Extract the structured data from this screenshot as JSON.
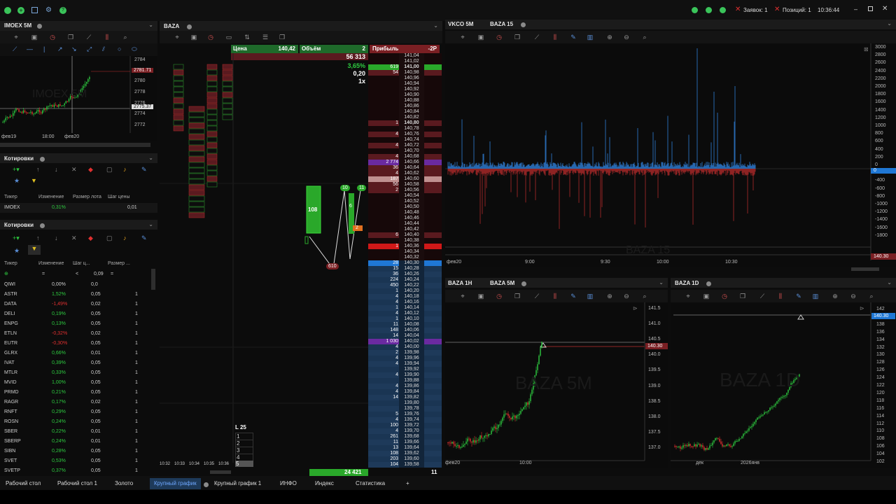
{
  "topbar": {
    "orders_label": "Заявок: 1",
    "positions_label": "Позиций: 1",
    "time": "10:36:44"
  },
  "left_chart": {
    "title": "IMOEX 5M",
    "watermark": "IMOEX 5M",
    "price_ticks": [
      "2784",
      "2780",
      "2778",
      "2776",
      "2774",
      "2772"
    ],
    "price_tag": "2781.71",
    "price_tag2": "2775.37",
    "time_ticks": [
      "фев19",
      "18:00",
      "фев20"
    ]
  },
  "quotes1": {
    "title": "Котировки",
    "headers": [
      "Тикер",
      "Изменение",
      "Размер лота",
      "Шаг цены"
    ],
    "row": {
      "ticker": "IMOEX",
      "change": "0,31%",
      "lot": "",
      "step": "0,01"
    }
  },
  "quotes2": {
    "title": "Котировки",
    "headers": [
      "Тикер",
      "Изменение",
      "Шаг ц...",
      "Размер ..."
    ],
    "filter": {
      "sign": "<",
      "value": "0,09"
    },
    "rows": [
      {
        "t": "QIWI",
        "c": "0,00%",
        "s": "0,0",
        "l": ""
      },
      {
        "t": "ASTR",
        "c": "1,52%",
        "s": "0,05",
        "l": "1"
      },
      {
        "t": "DATA",
        "c": "-1,49%",
        "s": "0,02",
        "l": "1"
      },
      {
        "t": "DELI",
        "c": "0,19%",
        "s": "0,05",
        "l": "1"
      },
      {
        "t": "ENPG",
        "c": "0,13%",
        "s": "0,05",
        "l": "1"
      },
      {
        "t": "ETLN",
        "c": "-0,32%",
        "s": "0,02",
        "l": "1"
      },
      {
        "t": "EUTR",
        "c": "-0,30%",
        "s": "0,05",
        "l": "1"
      },
      {
        "t": "GLRX",
        "c": "0,66%",
        "s": "0,01",
        "l": "1"
      },
      {
        "t": "IVAT",
        "c": "0,39%",
        "s": "0,05",
        "l": "1"
      },
      {
        "t": "MTLR",
        "c": "0,33%",
        "s": "0,05",
        "l": "1"
      },
      {
        "t": "MVID",
        "c": "1,00%",
        "s": "0,05",
        "l": "1"
      },
      {
        "t": "PRMD",
        "c": "0,21%",
        "s": "0,05",
        "l": "1"
      },
      {
        "t": "RAGR",
        "c": "0,17%",
        "s": "0,02",
        "l": "1"
      },
      {
        "t": "RNFT",
        "c": "0,29%",
        "s": "0,05",
        "l": "1"
      },
      {
        "t": "ROSN",
        "c": "0,24%",
        "s": "0,05",
        "l": "1"
      },
      {
        "t": "SBER",
        "c": "0,22%",
        "s": "0,01",
        "l": "1"
      },
      {
        "t": "SBERP",
        "c": "0,24%",
        "s": "0,01",
        "l": "1"
      },
      {
        "t": "SIBN",
        "c": "0,28%",
        "s": "0,05",
        "l": "1"
      },
      {
        "t": "SVET",
        "c": "0,53%",
        "s": "0,05",
        "l": "1"
      },
      {
        "t": "SVETP",
        "c": "0,37%",
        "s": "0,05",
        "l": "1"
      }
    ]
  },
  "baza": {
    "title": "BAZA",
    "hdr_price_label": "Цена",
    "hdr_price": "140,42",
    "hdr_vol_label": "Объём",
    "hdr_vol": "2",
    "hdr_profit_label": "Прибыль",
    "hdr_profit": "-2Р",
    "total": "56 313",
    "pct": "3,65%",
    "spread": "0,20",
    "mult": "1x",
    "bottom_total": "24 421",
    "bottom_n": "11",
    "l25": "L 25",
    "levels": [
      "1",
      "2",
      "3",
      "4",
      "5"
    ],
    "times": [
      "10:32",
      "10:33",
      "10:34",
      "10:35",
      "10:36"
    ],
    "cluster_big": "108",
    "cluster_610": "610",
    "c10": "10",
    "c11": "11",
    "c6": "6",
    "c2": "2",
    "ladder": [
      {
        "p": "141,04",
        "v": ""
      },
      {
        "p": "141,02",
        "v": ""
      },
      {
        "p": "141,00",
        "v": "619",
        "b": 1
      },
      {
        "p": "140,98",
        "v": "54"
      },
      {
        "p": "140,96",
        "v": ""
      },
      {
        "p": "140,94",
        "v": ""
      },
      {
        "p": "140,92",
        "v": ""
      },
      {
        "p": "140,90",
        "v": ""
      },
      {
        "p": "140,88",
        "v": ""
      },
      {
        "p": "140,86",
        "v": ""
      },
      {
        "p": "140,84",
        "v": ""
      },
      {
        "p": "140,82",
        "v": ""
      },
      {
        "p": "140,80",
        "v": "1",
        "b": 1
      },
      {
        "p": "140,78",
        "v": ""
      },
      {
        "p": "140,76",
        "v": "4"
      },
      {
        "p": "140,74",
        "v": ""
      },
      {
        "p": "140,72",
        "v": "4"
      },
      {
        "p": "140,70",
        "v": ""
      },
      {
        "p": "140,68",
        "v": "4"
      },
      {
        "p": "140,66",
        "v": "2 774"
      },
      {
        "p": "140,64",
        "v": "36"
      },
      {
        "p": "140,62",
        "v": "4"
      },
      {
        "p": "140,60",
        "v": "187"
      },
      {
        "p": "140,58",
        "v": "56"
      },
      {
        "p": "140,56",
        "v": "2"
      },
      {
        "p": "140,54",
        "v": ""
      },
      {
        "p": "140,52",
        "v": ""
      },
      {
        "p": "140,50",
        "v": ""
      },
      {
        "p": "140,48",
        "v": ""
      },
      {
        "p": "140,46",
        "v": ""
      },
      {
        "p": "140,44",
        "v": ""
      },
      {
        "p": "140,42",
        "v": ""
      },
      {
        "p": "140,40",
        "v": "6"
      },
      {
        "p": "140,38",
        "v": ""
      },
      {
        "p": "140,36",
        "v": "1"
      },
      {
        "p": "140,34",
        "v": ""
      },
      {
        "p": "140,32",
        "v": ""
      },
      {
        "p": "140,30",
        "v": "28"
      },
      {
        "p": "140,28",
        "v": "15"
      },
      {
        "p": "140,26",
        "v": "36"
      },
      {
        "p": "140,24",
        "v": "224"
      },
      {
        "p": "140,22",
        "v": "450"
      },
      {
        "p": "140,20",
        "v": "1"
      },
      {
        "p": "140,18",
        "v": "4"
      },
      {
        "p": "140,16",
        "v": "4"
      },
      {
        "p": "140,14",
        "v": "1"
      },
      {
        "p": "140,12",
        "v": "4"
      },
      {
        "p": "140,10",
        "v": "1"
      },
      {
        "p": "140,08",
        "v": "11"
      },
      {
        "p": "140,06",
        "v": "148"
      },
      {
        "p": "140,04",
        "v": "14"
      },
      {
        "p": "140,02",
        "v": "1 030"
      },
      {
        "p": "140,00",
        "v": "4"
      },
      {
        "p": "139,98",
        "v": "2"
      },
      {
        "p": "139,96",
        "v": "4"
      },
      {
        "p": "139,94",
        "v": "4"
      },
      {
        "p": "139,92",
        "v": ""
      },
      {
        "p": "139,90",
        "v": "4"
      },
      {
        "p": "139,88",
        "v": ""
      },
      {
        "p": "139,86",
        "v": "4"
      },
      {
        "p": "139,84",
        "v": "4"
      },
      {
        "p": "139,82",
        "v": "14"
      },
      {
        "p": "139,80",
        "v": ""
      },
      {
        "p": "139,78",
        "v": ""
      },
      {
        "p": "139,76",
        "v": "5"
      },
      {
        "p": "139,74",
        "v": "4"
      },
      {
        "p": "139,72",
        "v": "100"
      },
      {
        "p": "139,70",
        "v": "4"
      },
      {
        "p": "139,68",
        "v": "261"
      },
      {
        "p": "139,66",
        "v": "11"
      },
      {
        "p": "139,64",
        "v": "13"
      },
      {
        "p": "139,62",
        "v": "108"
      },
      {
        "p": "139,60",
        "v": "203"
      },
      {
        "p": "139,58",
        "v": "104"
      }
    ]
  },
  "vkco": {
    "tabs": [
      "VKCO 5M",
      "BAZA 15"
    ],
    "watermark": "BAZA 15",
    "y_ticks": [
      "3000",
      "2800",
      "2600",
      "2400",
      "2200",
      "2000",
      "1800",
      "1600",
      "1400",
      "1200",
      "1000",
      "800",
      "600",
      "400",
      "200",
      "0",
      "-200",
      "-400",
      "-600",
      "-800",
      "-1000",
      "-1200",
      "-1400",
      "-1600",
      "-1800"
    ],
    "x_ticks": [
      "фев20",
      "9:00",
      "9:30",
      "10:00",
      "10:30"
    ],
    "price_tag": "140.30"
  },
  "baza5m": {
    "tabs": [
      "BAZA 1H",
      "BAZA 5M"
    ],
    "watermark": "BAZA 5M",
    "y_ticks": [
      "141.5",
      "141.0",
      "140.5",
      "140.0",
      "139.5",
      "139.0",
      "138.5",
      "138.0",
      "137.5",
      "137.0"
    ],
    "x_ticks": [
      "фев20",
      "10:00"
    ],
    "price_tag": "140.30"
  },
  "baza1d": {
    "tabs": [
      "BAZA 1D"
    ],
    "watermark": "BAZA 1D",
    "y_ticks": [
      "142",
      "140",
      "138",
      "136",
      "134",
      "132",
      "130",
      "128",
      "126",
      "124",
      "122",
      "120",
      "118",
      "116",
      "114",
      "112",
      "110",
      "108",
      "106",
      "104",
      "102"
    ],
    "x_ticks": [
      "дек",
      "2026янв"
    ],
    "price_tag": "140.30"
  },
  "bottom_tabs": [
    "Рабочий стол",
    "Рабочий стол 1",
    "Золото",
    "Крупный график",
    "Крупный график 1",
    "ИНФО",
    "Индекс",
    "Статистика",
    "+"
  ],
  "colors": {
    "green": "#2ecc40",
    "red": "#e03030",
    "blue": "#2a6db0",
    "ask": "#5a1a1f",
    "bid": "#1e3a5a"
  }
}
